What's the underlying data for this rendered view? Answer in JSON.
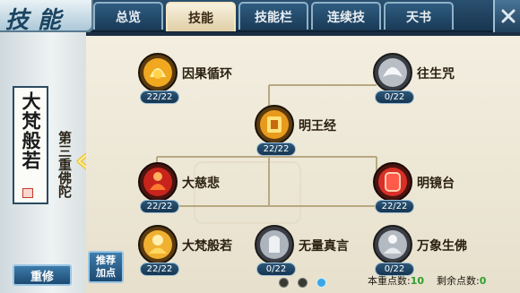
{
  "header": {
    "title": "技能",
    "tabs": [
      {
        "label": "总览",
        "active": false
      },
      {
        "label": "技能",
        "active": true
      },
      {
        "label": "技能栏",
        "active": false
      },
      {
        "label": "连续技",
        "active": false
      },
      {
        "label": "天书",
        "active": false
      }
    ]
  },
  "sidebar": {
    "scroll_title": "大梵般若",
    "stage_label": "第三重佛陀",
    "reset_label": "重修",
    "recommend_line1": "推荐",
    "recommend_line2": "加点"
  },
  "skills": [
    {
      "name": "因果循环",
      "level": "22/22",
      "icon": "golden-fist-icon"
    },
    {
      "name": "往生咒",
      "level": "0/22",
      "icon": "white-lotus-icon"
    },
    {
      "name": "明王经",
      "level": "22/22",
      "icon": "golden-shrine-icon"
    },
    {
      "name": "大慈悲",
      "level": "22/22",
      "icon": "red-buddha-icon"
    },
    {
      "name": "明镜台",
      "level": "22/22",
      "icon": "red-mirror-icon"
    },
    {
      "name": "大梵般若",
      "level": "22/22",
      "icon": "golden-monk-icon"
    },
    {
      "name": "无量真言",
      "level": "0/22",
      "icon": "white-hand-icon"
    },
    {
      "name": "万象生佛",
      "level": "0/22",
      "icon": "white-buddha-icon"
    }
  ],
  "pagination": {
    "count": 3,
    "active": 2
  },
  "footer": {
    "current_points_label": "本重点数:",
    "current_points_value": "10",
    "remaining_points_label": "剩余点数:",
    "remaining_points_value": "0"
  },
  "colors": {
    "gold": "#e8a628",
    "red": "#c8241c",
    "silver": "#c9ced6",
    "accent_blue": "#39a6e6"
  }
}
